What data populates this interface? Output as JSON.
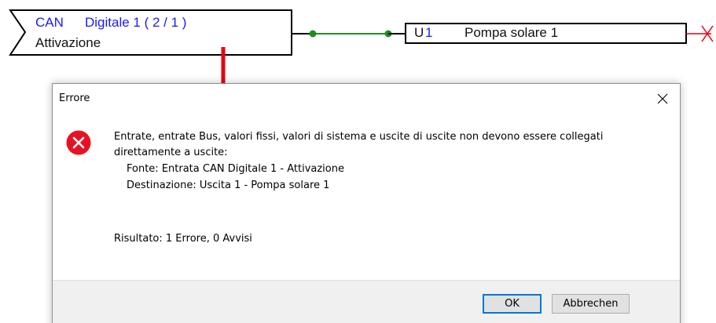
{
  "diagram": {
    "input_block": {
      "type_label": "CAN",
      "channel_label": "Digitale 1 ( 2 / 1 )",
      "value_label": "Attivazione"
    },
    "output_block": {
      "id_prefix": "U",
      "id_number": "1",
      "name": "Pompa solare 1"
    },
    "colors": {
      "block_border": "#000000",
      "connection_line": "#1f8f1f",
      "connection_node": "#1f8f1f",
      "arrow": "#e8000d",
      "label_blue": "#1a1aff",
      "output_cross": "#e8000d"
    }
  },
  "dialog": {
    "title": "Errore",
    "close_glyph": "✕",
    "icon": "error-icon",
    "message_line_1": "Entrate, entrate Bus, valori fissi, valori di sistema e uscite di uscite non devono essere collegati",
    "message_line_2": "direttamente a uscite:",
    "source_line": "Fonte: Entrata CAN Digitale 1 - Attivazione",
    "destination_line": "Destinazione: Uscita 1 - Pompa solare 1",
    "result_line": "Risultato: 1 Errore, 0 Avvisi",
    "ok_label": "OK",
    "cancel_label": "Abbrechen",
    "colors": {
      "error_icon": "#e81123",
      "default_button_border": "#0078d7",
      "footer_bg": "#f0f0f0"
    }
  }
}
